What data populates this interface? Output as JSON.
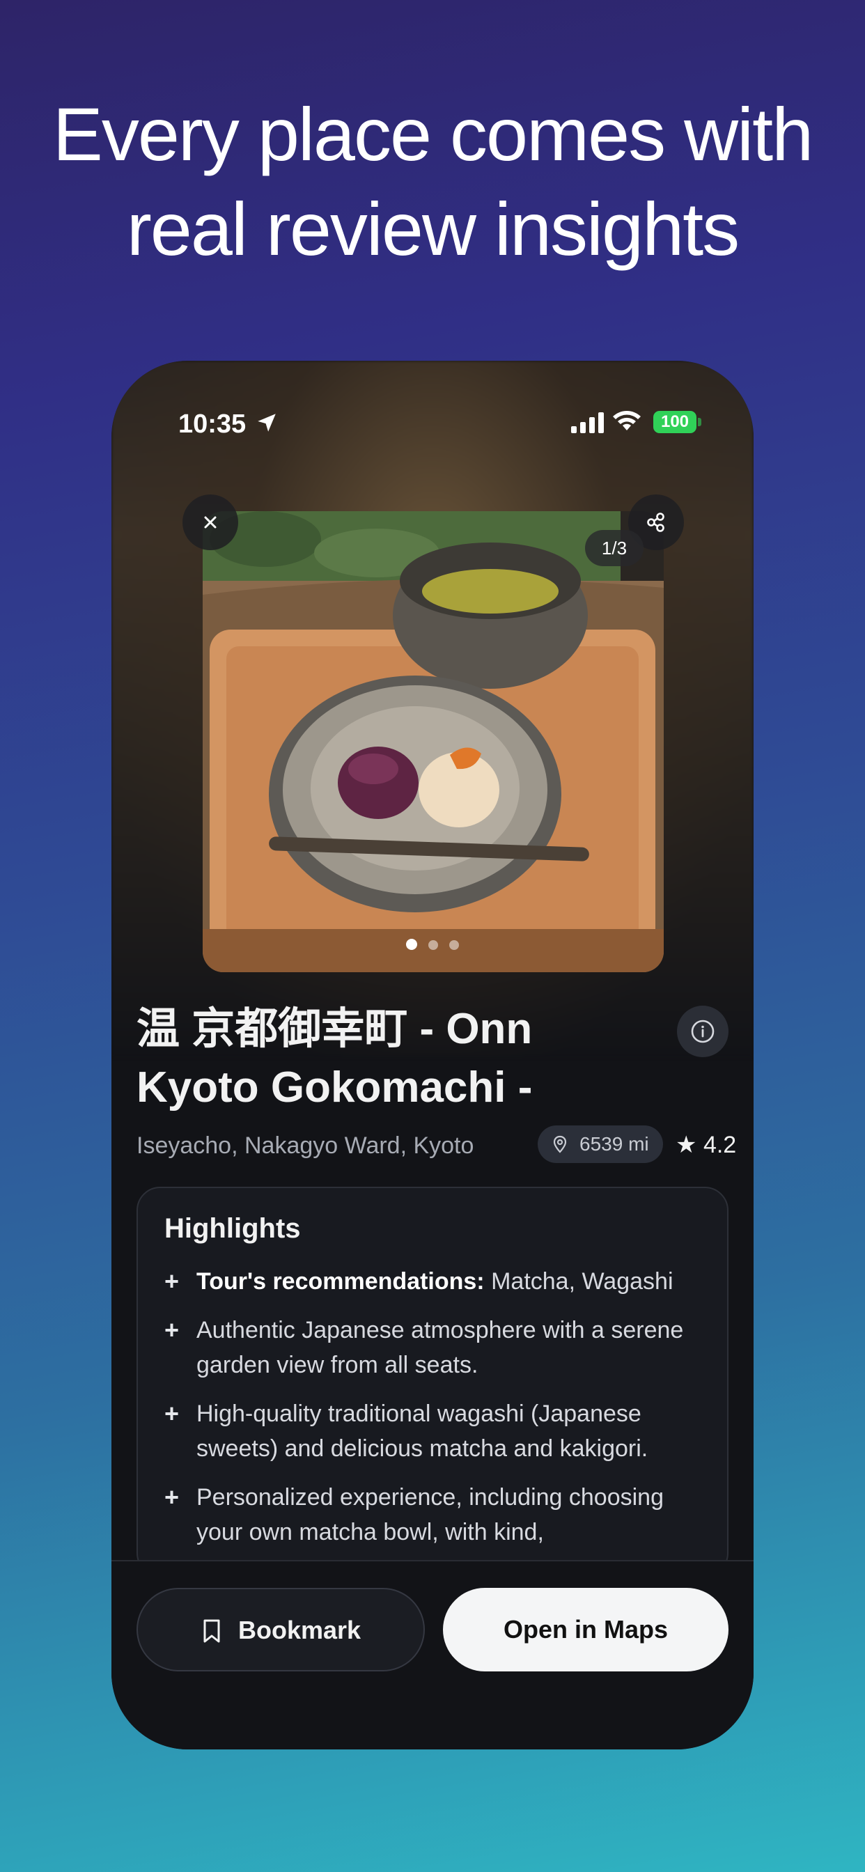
{
  "headline": {
    "line1": "Every place comes with",
    "line2": "real review insights"
  },
  "status_bar": {
    "time": "10:35",
    "battery": "100"
  },
  "gallery": {
    "counter": "1/3",
    "page_count": 3,
    "active_index": 0
  },
  "place": {
    "title": "温 京都御幸町 - Onn Kyoto Gokomachi -",
    "address": "Iseyacho, Nakagyo Ward, Kyoto",
    "distance": "6539 mi",
    "rating": "4.2"
  },
  "highlights": {
    "title": "Highlights",
    "items": [
      {
        "bold": "Tour's recommendations:",
        "text": " Matcha, Wagashi"
      },
      {
        "bold": "",
        "text": "Authentic Japanese atmosphere with a serene garden view from all seats."
      },
      {
        "bold": "",
        "text": "High-quality traditional wagashi (Japanese sweets) and delicious matcha and kakigori."
      },
      {
        "bold": "",
        "text": "Personalized experience, including choosing your own matcha bowl, with kind,"
      }
    ]
  },
  "actions": {
    "bookmark_label": "Bookmark",
    "maps_label": "Open in Maps"
  },
  "colors": {
    "accent": "#30d158",
    "background_top": "#302f86",
    "background_bottom": "#2fb5c2"
  },
  "icons": [
    "location-arrow-icon",
    "signal-icon",
    "wifi-icon",
    "close-icon",
    "share-icon",
    "info-icon",
    "pin-icon",
    "star-icon",
    "bookmark-icon"
  ]
}
